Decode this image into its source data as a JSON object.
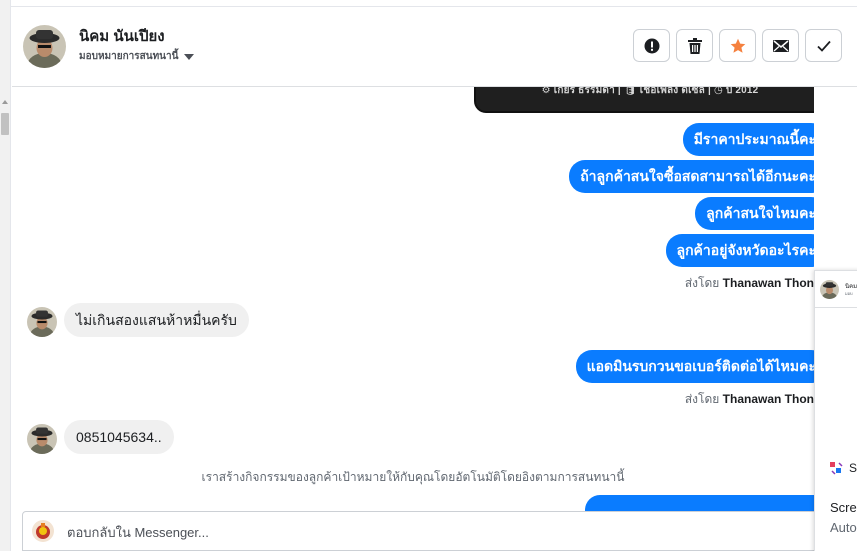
{
  "header": {
    "name": "นิคม นันเปียง",
    "assign_label": "มอบหมายการสนทนานี้"
  },
  "toolbar": {
    "icons": [
      "alert-icon",
      "trash-icon",
      "star-icon",
      "mail-icon",
      "check-icon"
    ],
    "star_color": "#f5813f"
  },
  "card": {
    "specs": "⚙ เกียร์ ธรรมดา  |  🛢 เชื้อเพลิง ดีเซล  |  ◷ ปี 2012"
  },
  "messages": {
    "out1": "มีราคาประมาณนี้คะ",
    "out2": "ถ้าลูกค้าสนใจซื้อสดสามารถได้อีกนะคะ",
    "out3": "ลูกค้าสนใจไหมคะ",
    "out4": "ลูกค้าอยู่จังหวัดอะไรคะ",
    "sent_by_prefix": "ส่งโดย",
    "sent_by_name": "Thanawan Thon",
    "in1": "ไม่เกินสองแสนห้าหมื่นครับ",
    "out5": "แอดมินรบกวนขอเบอร์ติดต่อได้ไหมคะ",
    "in2": "0851045634..",
    "system_note": "เราสร้างกิจกรรมของลูกค้าเป้าหมายให้กับคุณโดยอัตโนมัติโดยอิงตามการสนทนานี้"
  },
  "composer": {
    "placeholder": "ตอบกลับใน Messenger..."
  },
  "float_panel": {
    "name": "นิคม",
    "sub": "มอบ",
    "icon_label": "S",
    "line1": "Scre",
    "line2": "Auto"
  },
  "colors": {
    "bubble_out": "#0a7cff",
    "bubble_in": "#f0f0f0"
  }
}
